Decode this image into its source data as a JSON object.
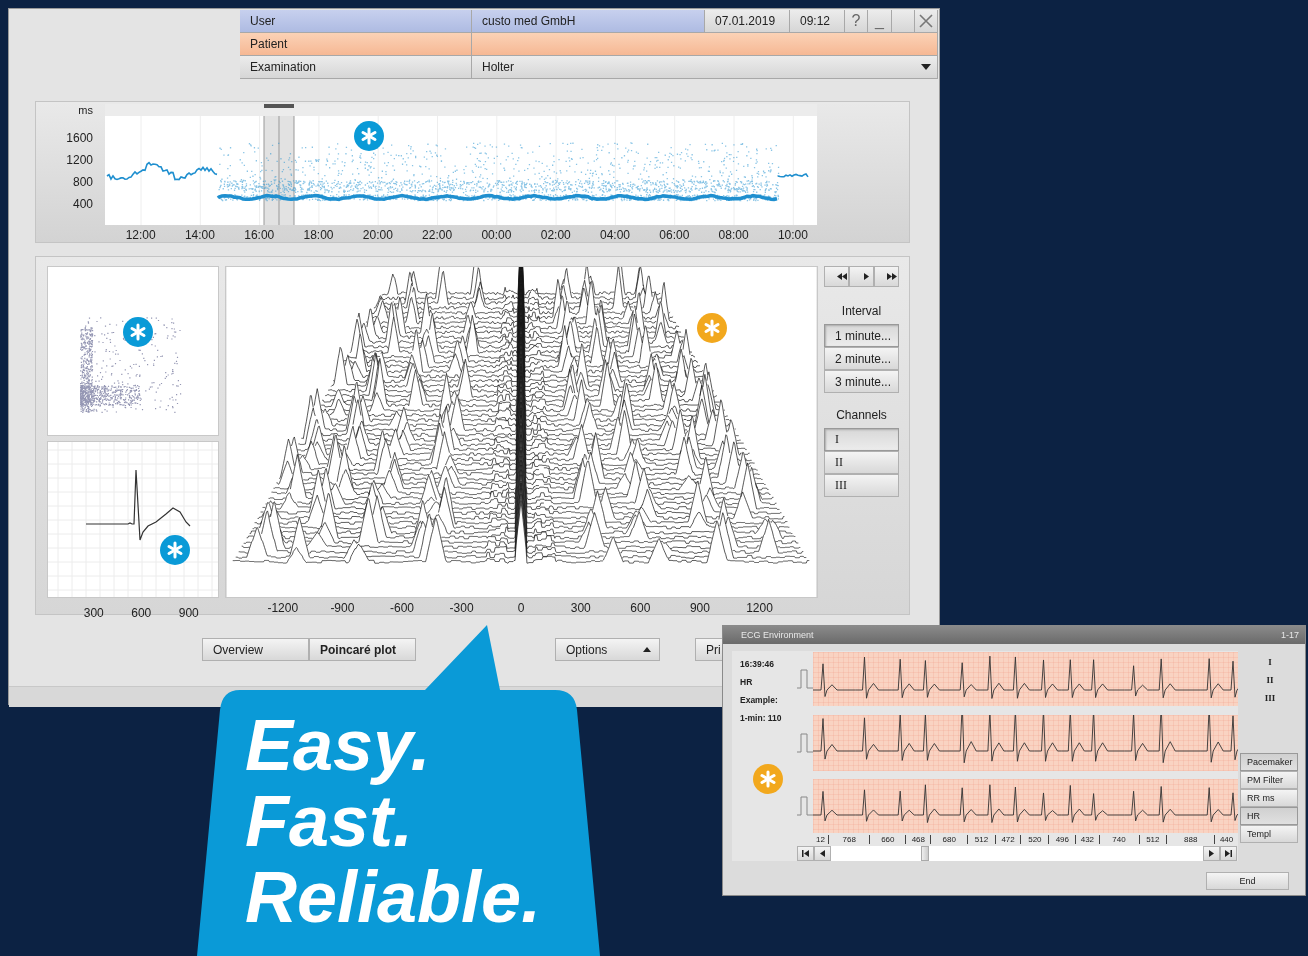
{
  "main_window": {
    "header": {
      "user_label": "User",
      "user_value": "custo med GmbH",
      "date": "07.01.2019",
      "time": "09:12",
      "help": "?",
      "minimize": "_",
      "patient_label": "Patient",
      "examination_label": "Examination",
      "examination_value": "Holter"
    },
    "trend": {
      "y_unit": "ms",
      "y_ticks": [
        "1600",
        "1200",
        "800",
        "400"
      ],
      "x_ticks": [
        "12:00",
        "14:00",
        "16:00",
        "18:00",
        "20:00",
        "22:00",
        "00:00",
        "02:00",
        "04:00",
        "06:00",
        "08:00",
        "10:00"
      ],
      "badge": {
        "color": "#0a9ad7"
      }
    },
    "poincare": {
      "x_ticks": [
        "300",
        "600",
        "900"
      ],
      "badge": {
        "color": "#0a9ad7"
      }
    },
    "template": {
      "badge": {
        "color": "#0a9ad7"
      }
    },
    "waterfall": {
      "x_ticks": [
        "-1200",
        "-900",
        "-600",
        "-300",
        "0",
        "300",
        "600",
        "900",
        "1200"
      ],
      "badge": {
        "color": "#f2a81d"
      }
    },
    "controls": {
      "interval_label": "Interval",
      "intervals": [
        {
          "label": "1 minute...",
          "selected": true
        },
        {
          "label": "2 minute...",
          "selected": false
        },
        {
          "label": "3 minute...",
          "selected": false
        }
      ],
      "channels_label": "Channels",
      "channels": [
        {
          "label": "I",
          "selected": true
        },
        {
          "label": "II",
          "selected": false
        },
        {
          "label": "III",
          "selected": false
        }
      ]
    },
    "tabs": [
      {
        "label": "Overview",
        "selected": false
      },
      {
        "label": "Poincaré plot",
        "selected": true
      }
    ],
    "options_button": "Options",
    "print_button": "Pri"
  },
  "ecg_window": {
    "title": "ECG Environment",
    "page": "1-17",
    "info": [
      "16:39:46",
      "HR",
      "Example:",
      "1-min: 110"
    ],
    "leads": [
      "I",
      "II",
      "III"
    ],
    "rr_values": [
      "12",
      "768",
      "660",
      "468",
      "680",
      "512",
      "472",
      "520",
      "496",
      "432",
      "740",
      "512",
      "888",
      "440"
    ],
    "toggles": [
      {
        "label": "Pacemaker",
        "on": true
      },
      {
        "label": "PM Filter",
        "on": false
      },
      {
        "label": "RR ms",
        "on": false
      },
      {
        "label": "HR",
        "on": true
      },
      {
        "label": "Templ",
        "on": false
      }
    ],
    "end_button": "End",
    "badge": {
      "color": "#f2a81d"
    }
  },
  "slogan": [
    "Easy.",
    "Fast.",
    "Reliable."
  ]
}
